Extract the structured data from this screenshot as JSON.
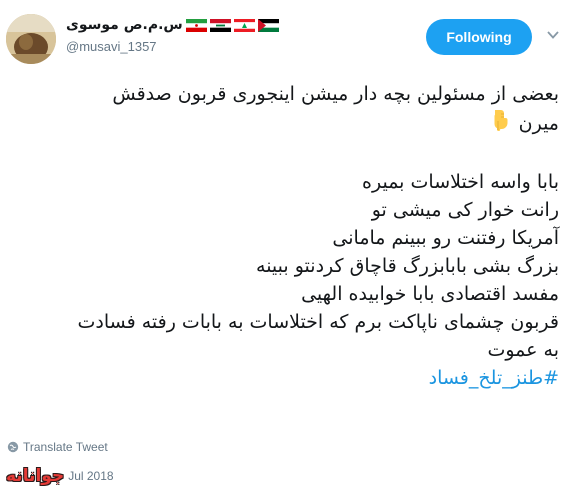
{
  "user": {
    "display_name": "س.م.ص موسوی",
    "handle": "@musavi_1357",
    "flags": [
      "palestine-flag",
      "lebanon-flag",
      "iraq-flag",
      "iran-flag"
    ]
  },
  "follow_button": {
    "label": "Following",
    "color": "#1da1f2"
  },
  "menu": {
    "icon": "chevron-down-icon"
  },
  "tweet": {
    "lines": [
      "بعضی از مسئولین بچه دار میشن اینجوری قربون صدقش",
      "میرن",
      "بابا واسه اختلاسات بمیره",
      "رانت خوار کی میشی تو",
      "آمریکا رفتنت رو ببینم مامانی",
      "بزرگ بشی بابابزرگ قاچاق کردنتو ببینه",
      "مفسد اقتصادی بابا خوابیده الهیی",
      "قربون چشمای ناپاکت برم که اختلاسات به بابات رفته فسادت",
      "به عموت"
    ],
    "emoji": "pointing-down-hand-icon",
    "hashtag": "#طنز_تلخ_فساد",
    "hashtag_color": "#1b95e0"
  },
  "translate": {
    "label": "Translate Tweet",
    "icon": "globe-icon"
  },
  "timestamp": {
    "text": "Jul 2018"
  },
  "watermark": {
    "text": "جوانانه"
  }
}
